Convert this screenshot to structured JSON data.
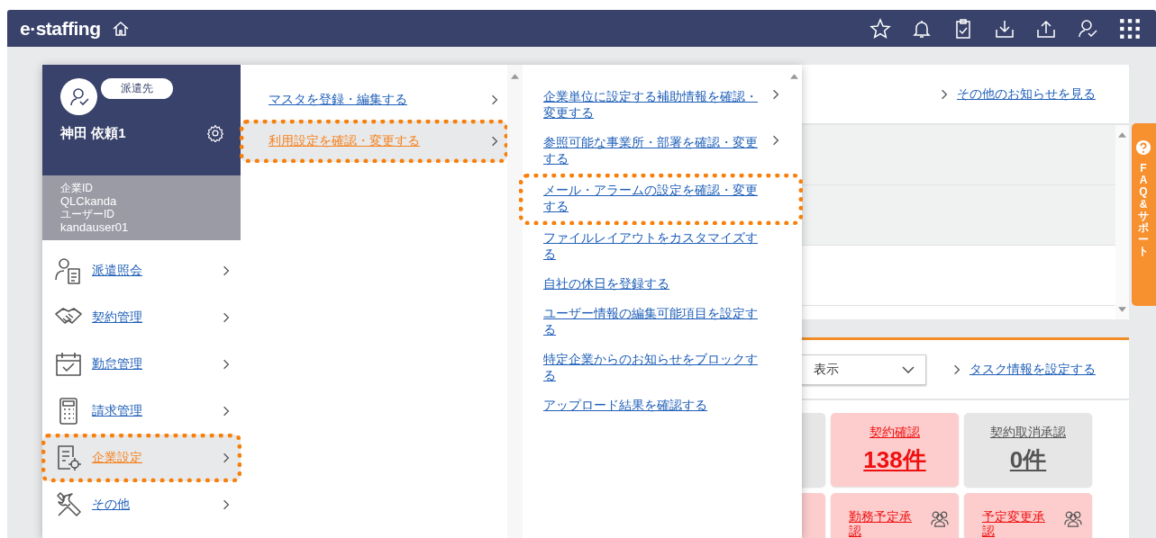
{
  "header": {
    "logo": "e·staffing"
  },
  "profile": {
    "role_badge": "派遣先",
    "name": "神田 依頼1",
    "company_id_label": "企業ID",
    "company_id": "QLCkanda",
    "user_id_label": "ユーザーID",
    "user_id": "kandauser01"
  },
  "menu": {
    "items": [
      {
        "label": "派遣照会",
        "kind": "dispatch",
        "selected": false
      },
      {
        "label": "契約管理",
        "kind": "contract",
        "selected": false
      },
      {
        "label": "勤怠管理",
        "kind": "attendance",
        "selected": false
      },
      {
        "label": "請求管理",
        "kind": "billing",
        "selected": false
      },
      {
        "label": "企業設定",
        "kind": "company",
        "selected": true
      },
      {
        "label": "その他",
        "kind": "other",
        "selected": false
      }
    ]
  },
  "submenu": {
    "items": [
      {
        "label": "マスタを登録・編集する",
        "selected": false
      },
      {
        "label": "利用設定を確認・変更する",
        "selected": true
      }
    ]
  },
  "settings_menu": {
    "items": [
      {
        "label": "企業単位に設定する補助情報を確認・変更する",
        "has_submenu": true,
        "highlighted": false
      },
      {
        "label": "参照可能な事業所・部署を確認・変更する",
        "has_submenu": true,
        "highlighted": false
      },
      {
        "label": "メール・アラームの設定を確認・変更する",
        "has_submenu": false,
        "highlighted": true
      },
      {
        "label": "ファイルレイアウトをカスタマイズする",
        "has_submenu": false,
        "highlighted": false
      },
      {
        "label": "自社の休日を登録する",
        "has_submenu": false,
        "highlighted": false
      },
      {
        "label": "ユーザー情報の編集可能項目を設定する",
        "has_submenu": false,
        "highlighted": false
      },
      {
        "label": "特定企業からのお知らせをブロックする",
        "has_submenu": false,
        "highlighted": false
      },
      {
        "label": "アップロード結果を確認する",
        "has_submenu": false,
        "highlighted": false
      }
    ]
  },
  "notices": {
    "link": "その他のお知らせを見る"
  },
  "tasks": {
    "filter": {
      "value": "表示"
    },
    "link": "タスク情報を設定する",
    "tiles": [
      {
        "kind": "normal"
      },
      {
        "label": "契約確認",
        "count": "138件",
        "kind": "alert"
      },
      {
        "label": "契約取消承認",
        "count": "0件",
        "kind": "normal"
      },
      {
        "kind": "alert"
      },
      {
        "label": "勤務予定承認",
        "kind": "alert",
        "group": true
      },
      {
        "label": "予定変更承認",
        "kind": "alert",
        "group": true
      }
    ]
  },
  "faq_tab": {
    "label": "FAQ&サポート"
  }
}
